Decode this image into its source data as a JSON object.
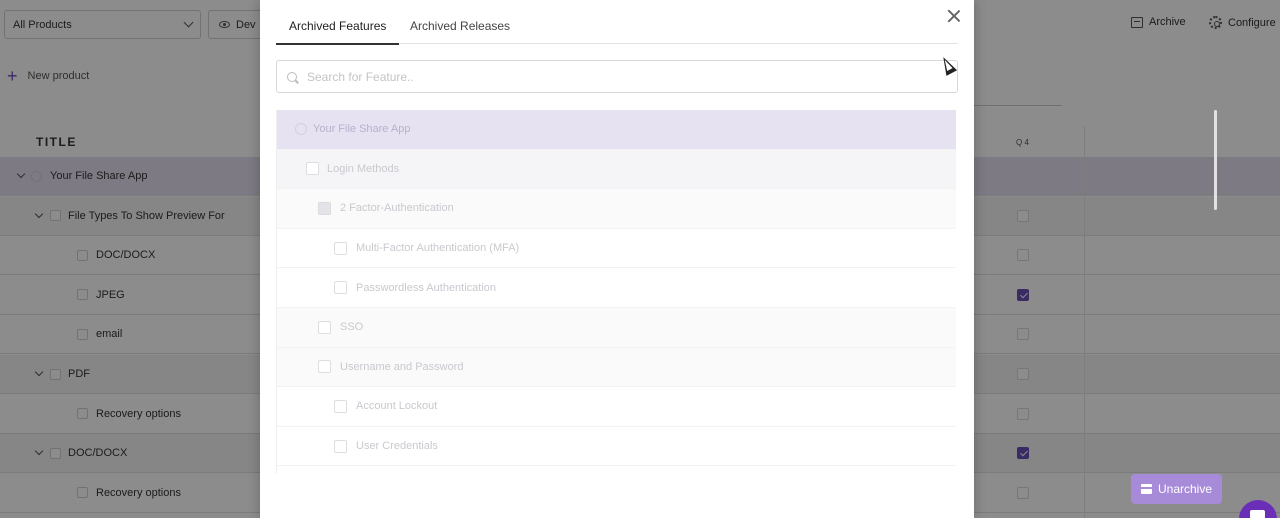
{
  "background": {
    "product_select": "All Products",
    "view_button": "Dev",
    "archive_link": "Archive",
    "configure_link": "Configure",
    "new_product": "New product",
    "title_header": "TITLE",
    "quarter_header": "Q 4",
    "rows": [
      {
        "label": "Your File Share App",
        "q4": null
      },
      {
        "label": "File Types To Show Preview For",
        "q4": false
      },
      {
        "label": "DOC/DOCX",
        "q4": false
      },
      {
        "label": "JPEG",
        "q4": true
      },
      {
        "label": "email",
        "q4": false
      },
      {
        "label": "PDF",
        "q4": false
      },
      {
        "label": "Recovery options",
        "q4": false
      },
      {
        "label": "DOC/DOCX",
        "q4": true
      },
      {
        "label": "Recovery options",
        "q4": false
      }
    ]
  },
  "modal": {
    "tabs": [
      {
        "label": "Archived Features",
        "active": true
      },
      {
        "label": "Archived Releases",
        "active": false
      }
    ],
    "search": {
      "placeholder": "Search for Feature..",
      "value": ""
    },
    "items": [
      {
        "label": "Your File Share App",
        "level": 0
      },
      {
        "label": "Login Methods",
        "level": 1
      },
      {
        "label": "2 Factor-Authentication",
        "level": 2
      },
      {
        "label": "Multi-Factor Authentication (MFA)",
        "level": 3
      },
      {
        "label": "Passwordless Authentication",
        "level": 3
      },
      {
        "label": "SSO",
        "level": 2
      },
      {
        "label": "Username and Password",
        "level": 2
      },
      {
        "label": "Account Lockout",
        "level": 3
      },
      {
        "label": "User Credentials",
        "level": 3
      }
    ],
    "unarchive_button": "Unarchive"
  },
  "colors": {
    "accent": "#6a4fb6",
    "unarchive": "#a88bd8",
    "highlight": "#e6e2f2"
  }
}
